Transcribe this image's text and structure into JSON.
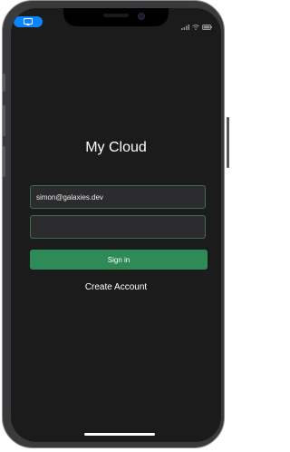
{
  "app": {
    "title": "My Cloud"
  },
  "login": {
    "email_value": "simon@galaxies.dev",
    "password_value": "",
    "sign_in_label": "Sign in",
    "create_account_label": "Create Account"
  },
  "status_bar": {
    "screen_share_icon": "screen-mirroring-icon",
    "signal_icon": "signal-icon",
    "wifi_icon": "wifi-icon",
    "battery_icon": "battery-icon"
  },
  "colors": {
    "background": "#1b1b1b",
    "field_background": "#2c2c2e",
    "field_border": "#3e6b4c",
    "primary_button": "#2e8b57",
    "status_pill": "#0a84ff"
  }
}
